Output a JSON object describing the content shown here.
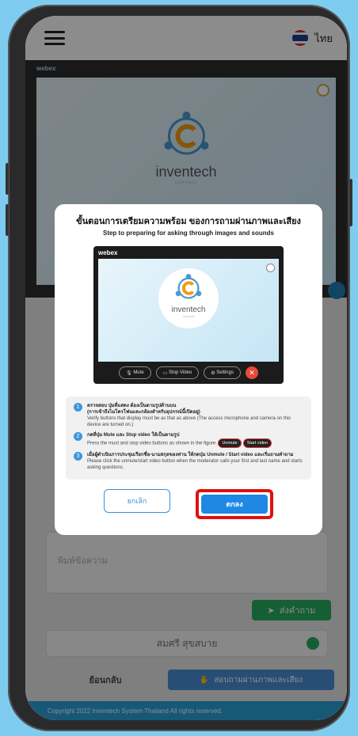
{
  "header": {
    "language": "ไทย"
  },
  "stage": {
    "brand": "webex",
    "logo_word": "inventech",
    "logo_sub": "connect"
  },
  "form": {
    "message_placeholder": "พิมพ์ข้อความ",
    "send_label": "ส่งคำถาม",
    "participant_name": "สมศรี สุขสบาย",
    "back_label": "ย้อนกลับ",
    "ask_av_label": "สอบถามผ่านภาพและเสียง"
  },
  "footer": {
    "text": "Copyright 2022 Inventech System Thailand All rights reserved."
  },
  "modal": {
    "title": "ขั้นตอนการเตรียมความพร้อม ของการถามผ่านภาพและเสียง",
    "subtitle": "Step to preparing for asking through images and sounds",
    "preview": {
      "brand": "webex",
      "logo_word": "inventech",
      "logo_sub": "connect",
      "controls": [
        "Mute",
        "Stop Video",
        "Settings"
      ]
    },
    "steps": [
      {
        "num": "1",
        "th_bold": "ตรวจสอบ ปุ่มที่แสดง ต้องเป็นตามรูปด้านบน",
        "th_note": "(การเข้าถึงไมโครโฟนและกล้องสำหรับอุปกรณ์นี้เปิดอยู่)",
        "en": "Verify buttons that display must be as that as above (The access microphone and camera on this device are turned on.)"
      },
      {
        "num": "2",
        "th_bold": "กดที่ปุ่ม Mute และ Stop video ให้เป็นตามรูป",
        "en": "Press the must and stop video buttons as shown in the figure.",
        "mini_unmute": "Unmute",
        "mini_start": "Start video"
      },
      {
        "num": "3",
        "th_bold": "เมื่อผู้ดำเนินการประชุมเรียกชื่อ-นามสกุลของท่าน ให้กดปุ่ม Unmute / Start video และเริ่มถามคำถาม",
        "en": "Please click the unmute/start video button when the moderator calls your first and last name and starts asking questions."
      }
    ],
    "cancel_label": "ยกเลิก",
    "ok_label": "ตกลง"
  },
  "colors": {
    "accent": "#1f88e5",
    "highlight": "#e01010",
    "footer": "#2aa1d9",
    "send": "#27ae60"
  }
}
